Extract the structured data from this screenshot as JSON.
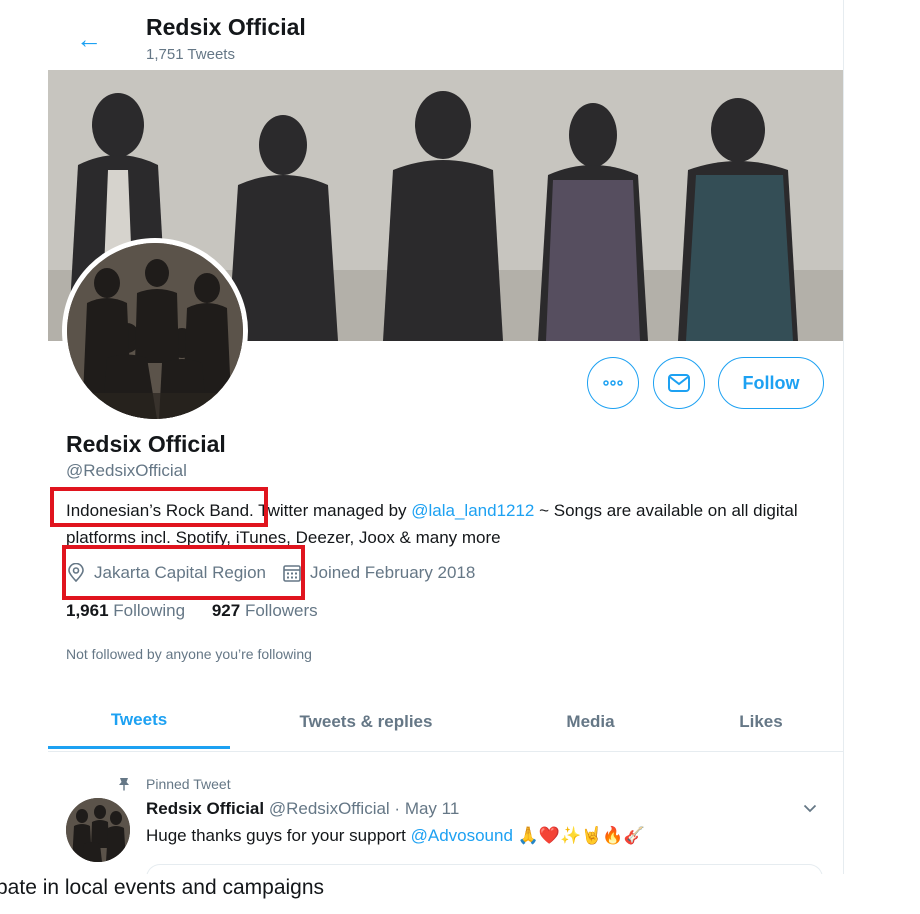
{
  "header": {
    "back_icon": "arrow-left-icon",
    "title": "Redsix Official",
    "tweet_count": "1,751 Tweets"
  },
  "actions": {
    "more_icon": "more-horizontal-icon",
    "message_icon": "envelope-icon",
    "follow_label": "Follow"
  },
  "profile": {
    "name": "Redsix Official",
    "handle": "@RedsixOfficial",
    "bio_start": "Indonesian’s Rock Band. Twitter managed by ",
    "bio_link": "@lala_land1212",
    "bio_end": " ~ Songs are available on all digital platforms incl. Spotify, iTunes, Deezer, Joox & many more",
    "location_icon": "map-pin-icon",
    "location": "Jakarta Capital Region",
    "calendar_icon": "calendar-icon",
    "joined": "Joined February 2018",
    "following_count": "1,961",
    "following_label": "Following",
    "followers_count": "927",
    "followers_label": "Followers",
    "not_followed": "Not followed by anyone you’re following"
  },
  "tabs": [
    {
      "label": "Tweets",
      "active": true
    },
    {
      "label": "Tweets & replies",
      "active": false
    },
    {
      "label": "Media",
      "active": false
    },
    {
      "label": "Likes",
      "active": false
    }
  ],
  "pinned_tweet": {
    "pin_icon": "pin-icon",
    "pinned_label": "Pinned Tweet",
    "author": "Redsix Official",
    "handle_date": "@RedsixOfficial · May 11",
    "text_start": "Huge thanks guys for your support ",
    "mention": "@Advosound",
    "emoji": "🙏❤️✨🤘🔥🎸",
    "chevron_icon": "chevron-down-icon"
  },
  "bottom_text": "pate in local events and campaigns",
  "colors": {
    "accent": "#1da1f2",
    "highlight": "#e0141e",
    "muted": "#657786"
  }
}
